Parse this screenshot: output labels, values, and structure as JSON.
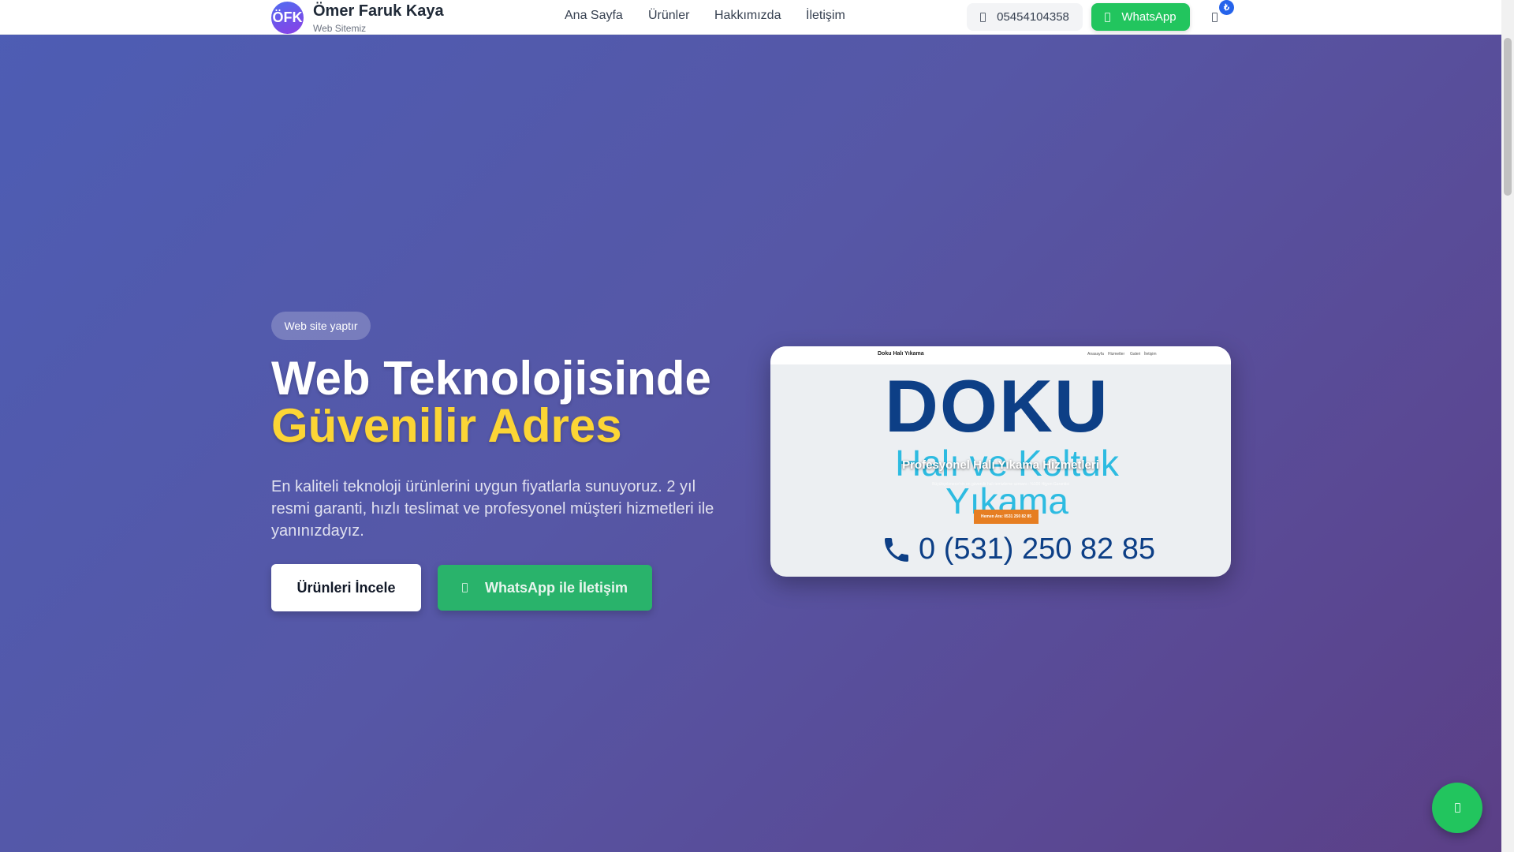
{
  "header": {
    "logo": "ÖFK",
    "brand": "Ömer Faruk Kaya",
    "tagline": "Web Sitemiz",
    "nav": [
      "Ana Sayfa",
      "Ürünler",
      "Hakkımızda",
      "İletişim"
    ],
    "phone": "05454104358",
    "whatsapp": "WhatsApp",
    "cart_badge": "₺"
  },
  "hero": {
    "badge": "Web site yaptır",
    "title_line1": "Web Teknolojisinde",
    "title_line2": "Güvenilir Adres",
    "description": "En kaliteli teknoloji ürünlerini uygun fiyatlarla sunuyoruz. 2 yıl resmi garanti, hızlı teslimat ve profesyonel müşteri hizmetleri ile yanınızdayız.",
    "primary_button": "Ürünleri İncele",
    "whatsapp_button": "WhatsApp ile İletişim"
  },
  "preview": {
    "site_name": "Doku Halı Yıkama",
    "nav": [
      "Anasayfa",
      "Hizmetler",
      "Galeri",
      "İletişim"
    ],
    "logo_big": "DOKU",
    "logo_sub": "Halı ve Koltuk Yıkama",
    "title": "Profesyonel Halı Yıkama Hizmetleri",
    "subtitle": "Büyükçekmece'nin en güvenilir halı temizleme uzmanı - %100 Hijyen Garantisi",
    "cta": "Hemen Ara: 0531 250 82 85",
    "phone": "0 (531) 250 82 85"
  },
  "colors": {
    "accent_yellow": "#fcd535",
    "whatsapp_green": "#22c55e"
  }
}
